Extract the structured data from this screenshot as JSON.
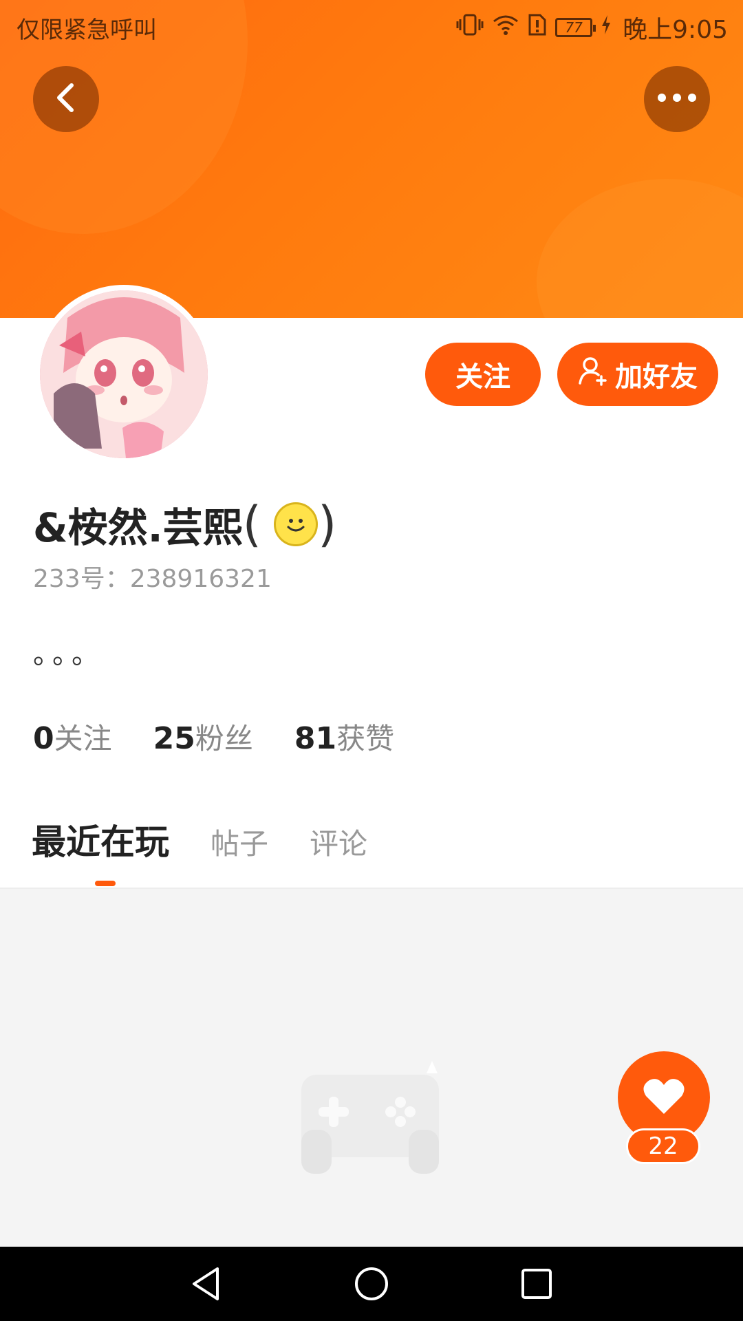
{
  "status_bar": {
    "carrier": "仅限紧急呼叫",
    "battery": "77",
    "time": "晚上9:05"
  },
  "header": {
    "back_icon": "chevron-left-icon",
    "more_icon": "ellipsis-icon"
  },
  "actions": {
    "follow_label": "关注",
    "add_friend_label": "加好友"
  },
  "profile": {
    "nickname": "&桉然.芸熙",
    "uid_label": "233号：",
    "uid_value": "238916321",
    "bio": "。。。"
  },
  "stats": [
    {
      "value": "0",
      "label": "关注"
    },
    {
      "value": "25",
      "label": "粉丝"
    },
    {
      "value": "81",
      "label": "获赞"
    }
  ],
  "tabs": [
    {
      "label": "最近在玩",
      "active": true
    },
    {
      "label": "帖子",
      "active": false
    },
    {
      "label": "评论",
      "active": false
    }
  ],
  "like": {
    "count": "22"
  },
  "colors": {
    "accent": "#ff5a0c",
    "banner": "#ff7a0e"
  }
}
